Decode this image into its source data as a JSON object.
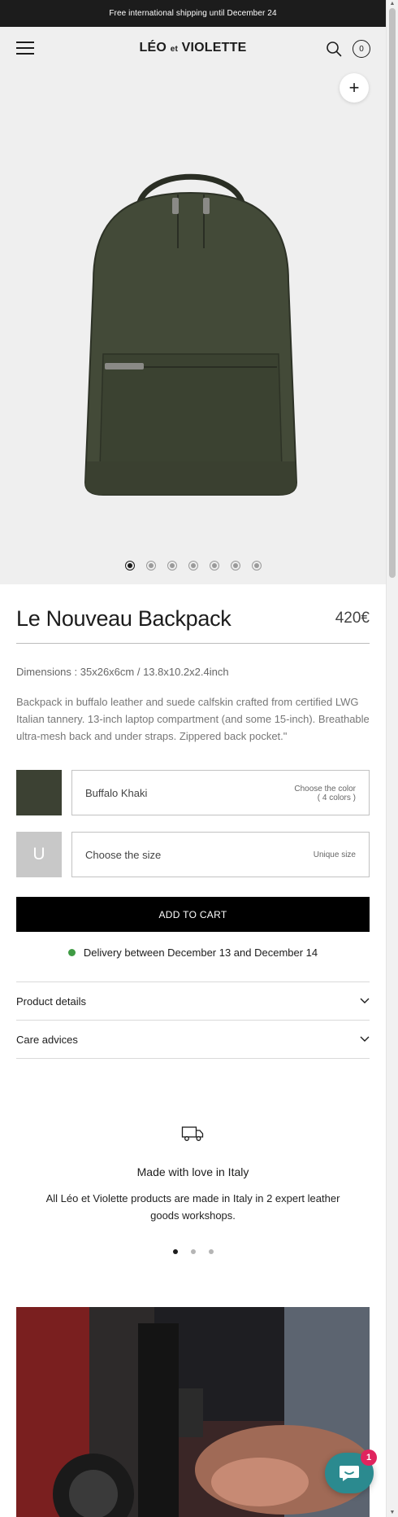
{
  "announcement": "Free international shipping until December 24",
  "header": {
    "logo_main": "LÉO",
    "logo_small": "et",
    "logo_end": "VIOLETTE",
    "cart_count": "0"
  },
  "gallery": {
    "image_count": 7,
    "active_index": 0,
    "zoom_label": "+"
  },
  "product": {
    "title": "Le Nouveau Backpack",
    "price": "420€",
    "dimensions": "Dimensions : 35x26x6cm / 13.8x10.2x2.4inch",
    "description": "Backpack in buffalo leather and suede calfskin crafted from certified LWG Italian tannery. 13-inch laptop compartment (and some 15-inch). Breathable ultra-mesh back and under straps. Zippered back pocket.\""
  },
  "color_option": {
    "value": "Buffalo Khaki",
    "hint_line1": "Choose the color",
    "hint_line2": "( 4 colors )",
    "swatch_color": "#3c4133"
  },
  "size_option": {
    "tile_letter": "U",
    "value": "Choose the size",
    "hint": "Unique size"
  },
  "add_to_cart_label": "ADD TO CART",
  "delivery": {
    "text": "Delivery between December 13 and December 14",
    "status_color": "#3f9b44"
  },
  "accordions": [
    {
      "label": "Product details"
    },
    {
      "label": "Care advices"
    }
  ],
  "feature": {
    "icon": "delivery-truck-icon",
    "title": "Made with love in Italy",
    "text": "All Léo et Violette products are made in Italy in 2 expert leather goods workshops.",
    "slide_count": 3,
    "active_slide": 0
  },
  "chat": {
    "icon": "chat-bubble-icon",
    "badge": "1"
  }
}
